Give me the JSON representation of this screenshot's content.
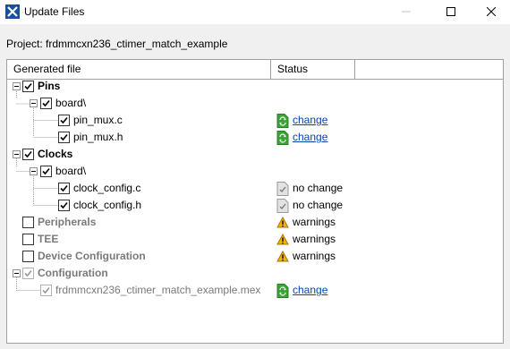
{
  "window": {
    "title": "Update Files",
    "min_icon": "minimize-icon",
    "max_icon": "maximize-icon",
    "close_icon": "close-icon"
  },
  "project_line": "Project: frdmmcxn236_ctimer_match_example",
  "columns": {
    "file": "Generated file",
    "status": "Status"
  },
  "tree": {
    "pins": {
      "label": "Pins",
      "board": "board\\",
      "files": [
        {
          "name": "pin_mux.c",
          "status": "change"
        },
        {
          "name": "pin_mux.h",
          "status": "change"
        }
      ]
    },
    "clocks": {
      "label": "Clocks",
      "board": "board\\",
      "files": [
        {
          "name": "clock_config.c",
          "status": "no change"
        },
        {
          "name": "clock_config.h",
          "status": "no change"
        }
      ]
    },
    "peripherals": {
      "label": "Peripherals",
      "status": "warnings"
    },
    "tee": {
      "label": "TEE",
      "status": "warnings"
    },
    "device_config": {
      "label": "Device Configuration",
      "status": "warnings"
    },
    "configuration": {
      "label": "Configuration",
      "file": "frdmmcxn236_ctimer_match_example.mex",
      "status": "change"
    }
  },
  "colors": {
    "link": "#0645ad",
    "change_icon": "#3aa535",
    "warning_icon": "#f5b400",
    "muted_text": "#7a7a7a"
  }
}
